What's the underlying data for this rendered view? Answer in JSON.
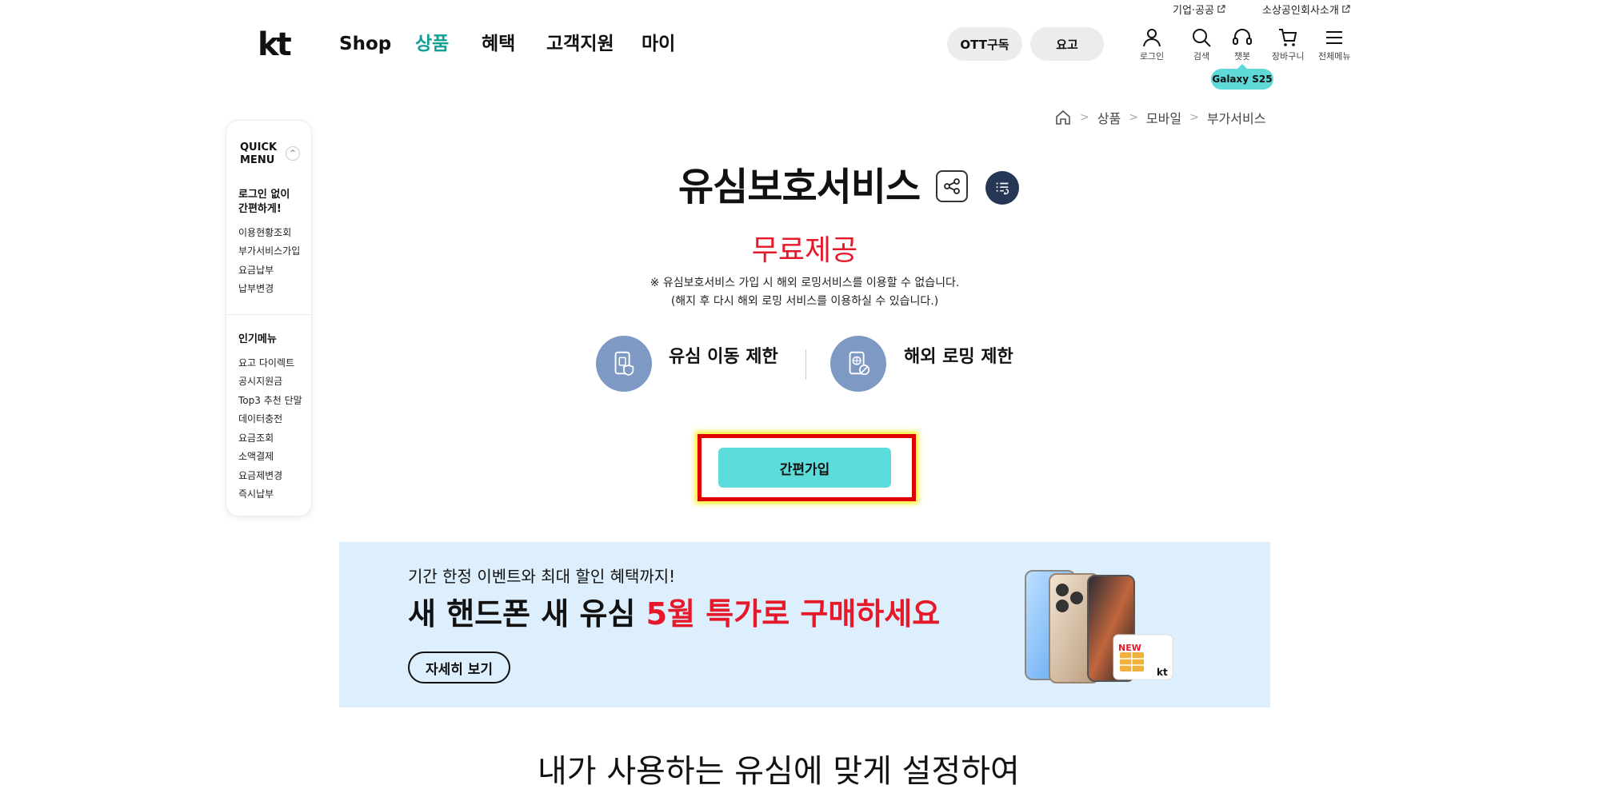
{
  "utility_links": [
    {
      "label": "기업·공공",
      "external": true
    },
    {
      "label": "소상공인",
      "external": false
    },
    {
      "label": "회사소개",
      "external": true
    }
  ],
  "logo": "kt",
  "gnb": [
    "Shop",
    "상품",
    "혜택",
    "고객지원",
    "마이"
  ],
  "gnb_active": "상품",
  "pills": [
    "OTT구독",
    "요고"
  ],
  "top_icons": [
    {
      "icon": "user-icon",
      "label": "로그인"
    },
    {
      "icon": "search-icon",
      "label": "검색"
    },
    {
      "icon": "headset-icon",
      "label": "챗봇"
    },
    {
      "icon": "cart-icon",
      "label": "장바구니"
    },
    {
      "icon": "menu-icon",
      "label": "전체메뉴"
    }
  ],
  "galaxy_badge": "Galaxy S25",
  "breadcrumb": [
    "상품",
    "모바일",
    "부가서비스"
  ],
  "quick_menu": {
    "title": "QUICK MENU",
    "section1_title": "로그인 없이 간편하게!",
    "section1_items": [
      "이용현황조회",
      "부가서비스가입",
      "요금납부",
      "납부변경"
    ],
    "section2_title": "인기메뉴",
    "section2_items": [
      "요고 다이렉트",
      "공시지원금",
      "Top3 추천 단말",
      "데이터충전",
      "요금조회",
      "소액결제",
      "요금제변경",
      "즉시납부"
    ]
  },
  "page": {
    "title": "유심보호서비스",
    "price": "무료제공",
    "notice_1": "※ 유심보호서비스 가입 시 해외 로밍서비스를 이용할 수 없습니다.",
    "notice_2": "(해지 후 다시 해외 로밍 서비스를 이용하실 수 있습니다.)",
    "feature_1": "유심 이동 제한",
    "feature_2": "해외 로밍 제한",
    "join_button": "간편가입"
  },
  "banner": {
    "subtitle": "기간 한정 이벤트와 최대 할인 혜택까지!",
    "title_black": "새 핸드폰 새 유심 ",
    "title_red": "5월 특가로 구매하세요",
    "button": "자세히 보기",
    "sim_new": "NEW",
    "sim_brand": "kt"
  },
  "bottom_heading": "내가 사용하는 유심에 맞게 설정하여",
  "colors": {
    "accent": "#0e9f95",
    "red": "#e6192a",
    "button_cyan": "#5ddcdc",
    "banner_bg": "#ddeefc"
  }
}
